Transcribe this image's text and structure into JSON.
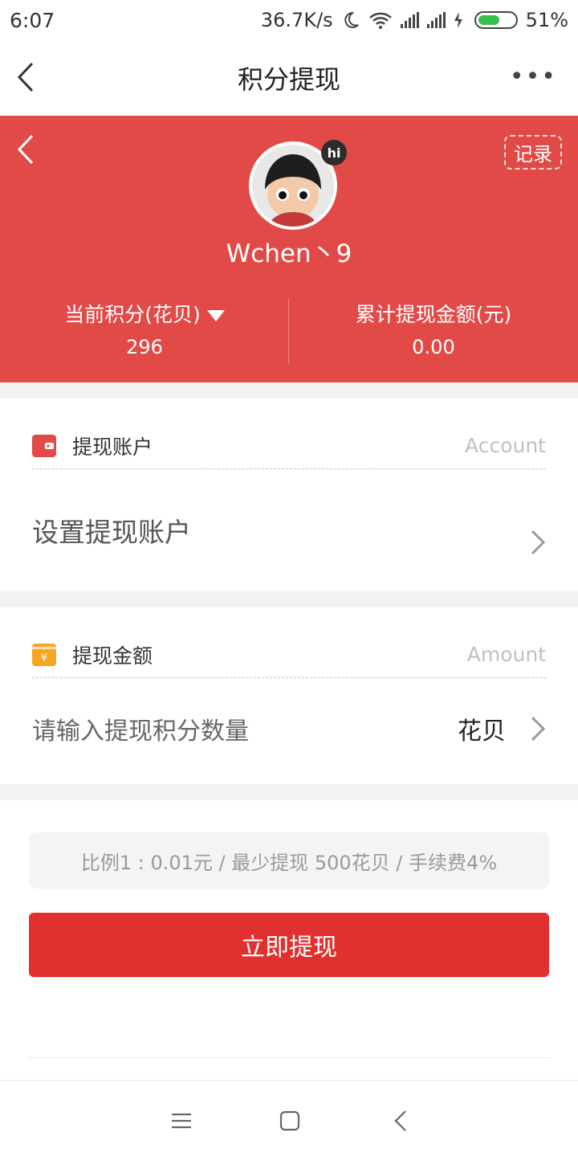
{
  "status_bar": {
    "time": "6:07",
    "speed": "36.7K/s",
    "battery": "51%"
  },
  "nav": {
    "title": "积分提现",
    "more": "•••"
  },
  "hero": {
    "record_label": "记录",
    "hi_badge": "hi",
    "username": "Wchen丶9",
    "points_label": "当前积分(花贝)",
    "points_value": "296",
    "withdrawn_label": "累计提现金额(元)",
    "withdrawn_value": "0.00"
  },
  "account_card": {
    "title": "提现账户",
    "en": "Account",
    "action": "设置提现账户"
  },
  "amount_card": {
    "title": "提现金额",
    "en": "Amount",
    "placeholder": "请输入提现积分数量",
    "unit": "花贝"
  },
  "info": {
    "ratio_text": "比例1 : 0.01元 / 最少提现 500花贝 / 手续费4%"
  },
  "submit_label": "立即提现",
  "colors": {
    "brand_red": "#e24a48",
    "button_red": "#e0302f"
  }
}
